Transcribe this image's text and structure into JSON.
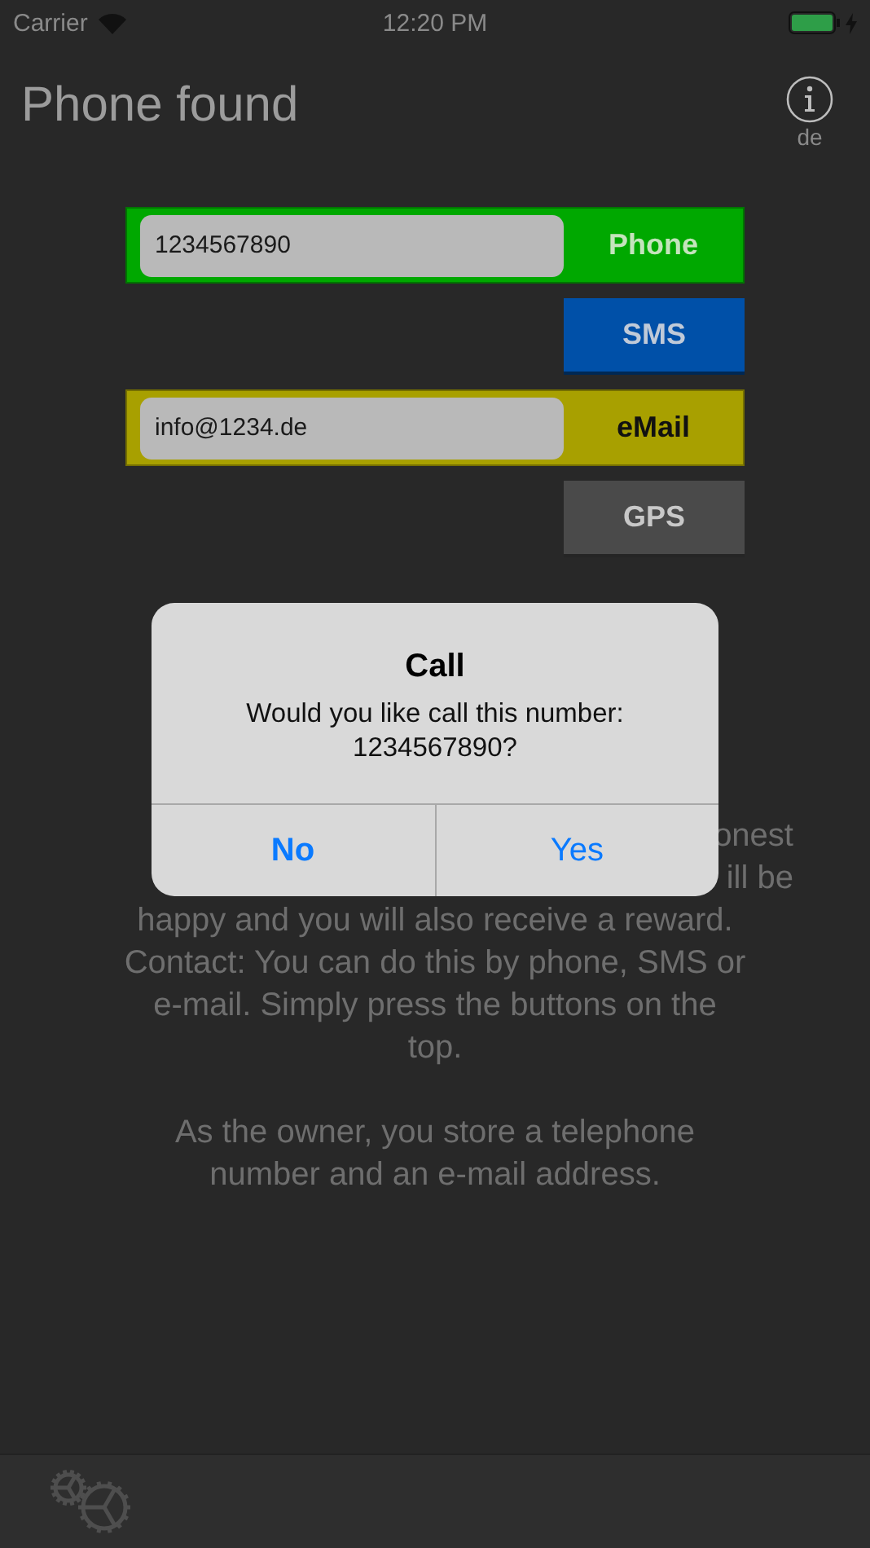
{
  "status_bar": {
    "carrier": "Carrier",
    "time": "12:20 PM"
  },
  "header": {
    "title": "Phone found",
    "language": "de"
  },
  "contacts": [
    {
      "kind": "field_button",
      "value": "1234567890",
      "button": "Phone",
      "color": "#00a800"
    },
    {
      "kind": "button",
      "button": "SMS",
      "color": "#0050a8"
    },
    {
      "kind": "field_button",
      "value": "info@1234.de",
      "button": "eMail",
      "color": "#a8a000"
    },
    {
      "kind": "button",
      "button": "GPS",
      "color": "#4a4a4a"
    }
  ],
  "info_text": {
    "covered_lines": [
      {
        "right": "onest"
      },
      {
        "right": "ill be"
      }
    ],
    "lines": [
      "happy and you will also receive a reward.",
      "Contact: You can do this by phone, SMS or",
      "e-mail. Simply press the buttons on the",
      "top."
    ],
    "paragraph": "As the owner, you store a telephone number and an e-mail address."
  },
  "dialog": {
    "title": "Call",
    "message": "Would you like call this number: 1234567890?",
    "buttons": [
      {
        "label": "No",
        "bold": true
      },
      {
        "label": "Yes",
        "bold": false
      }
    ]
  }
}
